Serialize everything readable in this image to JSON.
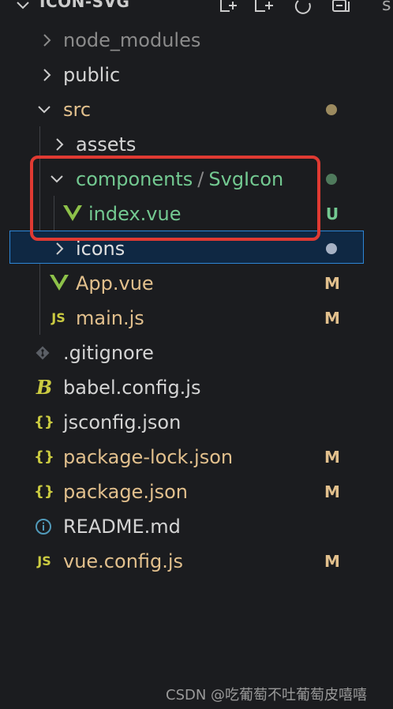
{
  "explorer": {
    "title": "ICON-SVG",
    "actions": [
      "new-file-icon",
      "new-folder-icon",
      "refresh-icon",
      "collapse-all-icon"
    ]
  },
  "colors": {
    "muted": "#8b8b8b",
    "text": "#d4d4d4",
    "green": "#73c991",
    "modified": "#e2c08d",
    "vue_icon": "#8dc149",
    "js_icon": "#cbcb41",
    "json_icon": "#cbcb41",
    "selection_border": "#2d86d6",
    "highlight_box": "#e03a32"
  },
  "tree": [
    {
      "name": "node_modules",
      "kind": "folder",
      "state": "collapsed"
    },
    {
      "name": "public",
      "kind": "folder",
      "state": "collapsed"
    },
    {
      "name": "src",
      "kind": "folder",
      "state": "expanded",
      "status": "dot"
    },
    {
      "name": "assets",
      "kind": "folder",
      "state": "collapsed"
    },
    {
      "name": "components",
      "separator": "/",
      "name2": "SvgIcon",
      "kind": "folder",
      "state": "expanded",
      "status": "dot"
    },
    {
      "name": "index.vue",
      "kind": "file",
      "icon": "vue-icon",
      "badge": "U"
    },
    {
      "name": "icons",
      "kind": "folder",
      "state": "collapsed",
      "status": "dot",
      "selected": true
    },
    {
      "name": "App.vue",
      "kind": "file",
      "icon": "vue-icon",
      "badge": "M"
    },
    {
      "name": "main.js",
      "kind": "file",
      "icon": "js-icon",
      "icon_text": "JS",
      "badge": "M"
    },
    {
      "name": ".gitignore",
      "kind": "file",
      "icon": "git-icon"
    },
    {
      "name": "babel.config.js",
      "kind": "file",
      "icon": "babel-icon",
      "icon_text": "B"
    },
    {
      "name": "jsconfig.json",
      "kind": "file",
      "icon": "json-icon",
      "icon_text": "{}"
    },
    {
      "name": "package-lock.json",
      "kind": "file",
      "icon": "json-icon",
      "icon_text": "{}",
      "badge": "M"
    },
    {
      "name": "package.json",
      "kind": "file",
      "icon": "json-icon",
      "icon_text": "{}",
      "badge": "M"
    },
    {
      "name": "README.md",
      "kind": "file",
      "icon": "info-icon"
    },
    {
      "name": "vue.config.js",
      "kind": "file",
      "icon": "js-icon",
      "icon_text": "JS",
      "badge": "M"
    }
  ],
  "watermark": "CSDN @吃葡萄不吐葡萄皮嘻嘻",
  "peek_text": "s"
}
